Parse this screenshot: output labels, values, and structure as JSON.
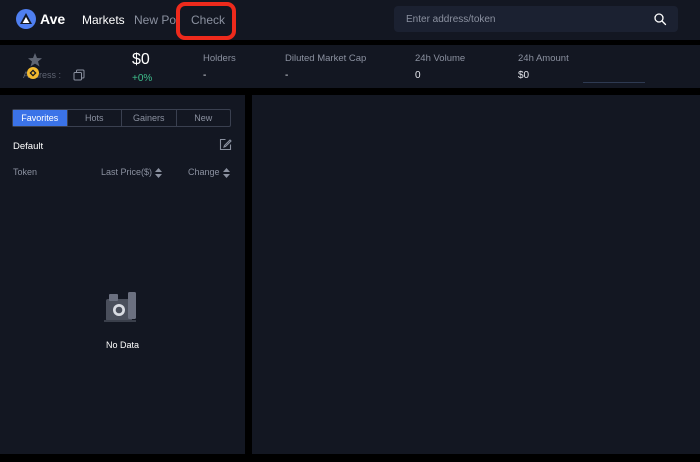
{
  "app": {
    "name": "Ave"
  },
  "nav": {
    "markets": "Markets",
    "new_pool": "New Pool",
    "check": "Check"
  },
  "search": {
    "placeholder": "Enter address/token",
    "value": ""
  },
  "token_info": {
    "address_label": "Address :",
    "price": "$0",
    "price_change": "+0%",
    "stats": [
      {
        "label": "Holders",
        "value": "-"
      },
      {
        "label": "Diluted Market Cap",
        "value": "-"
      },
      {
        "label": "24h Volume",
        "value": "0"
      },
      {
        "label": "24h Amount",
        "value": "$0"
      }
    ]
  },
  "watchlist": {
    "tabs": [
      "Favorites",
      "Hots",
      "Gainers",
      "New"
    ],
    "active_tab": "Favorites",
    "group": "Default",
    "columns": {
      "token": "Token",
      "last_price": "Last Price($)",
      "change": "Change"
    },
    "empty_text": "No Data"
  },
  "colors": {
    "background": "#000000",
    "panel": "#131722",
    "accent": "#3b73e8",
    "positive": "#3fbf8c",
    "highlight_annotation": "#ee2a1c"
  },
  "icons": {
    "logo": "ave-logo-icon",
    "search": "search-icon",
    "favorite": "star-icon",
    "chain": "coin-icon",
    "copy": "copy-icon",
    "edit": "edit-icon",
    "sort": "sort-icon",
    "empty": "empty-data-icon"
  }
}
